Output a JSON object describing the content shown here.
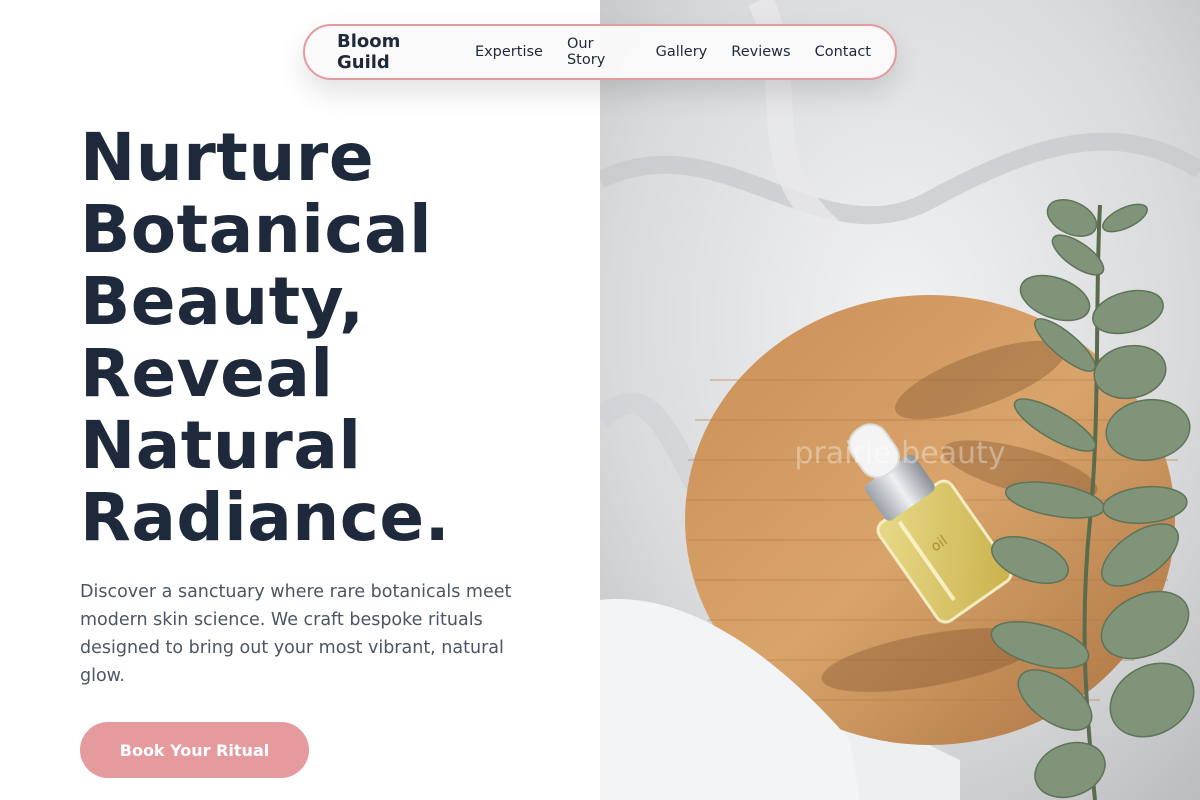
{
  "nav": {
    "brand": "Bloom Guild",
    "links": [
      "Expertise",
      "Our Story",
      "Gallery",
      "Reviews",
      "Contact"
    ]
  },
  "hero": {
    "headline_lines": [
      "Nurture",
      "Botanical",
      "Beauty,",
      "Reveal",
      "Natural",
      "Radiance."
    ],
    "lede": "Discover a sanctuary where rare botanicals meet modern skin science. We craft bespoke rituals designed to bring out your most vibrant, natural glow.",
    "cta_label": "Book Your Ritual"
  },
  "photo": {
    "watermark": "prairie beauty",
    "bottle_label": "oil"
  },
  "colors": {
    "accent": "#e59a9e",
    "heading": "#1e293b",
    "body_text": "#4b5563"
  }
}
